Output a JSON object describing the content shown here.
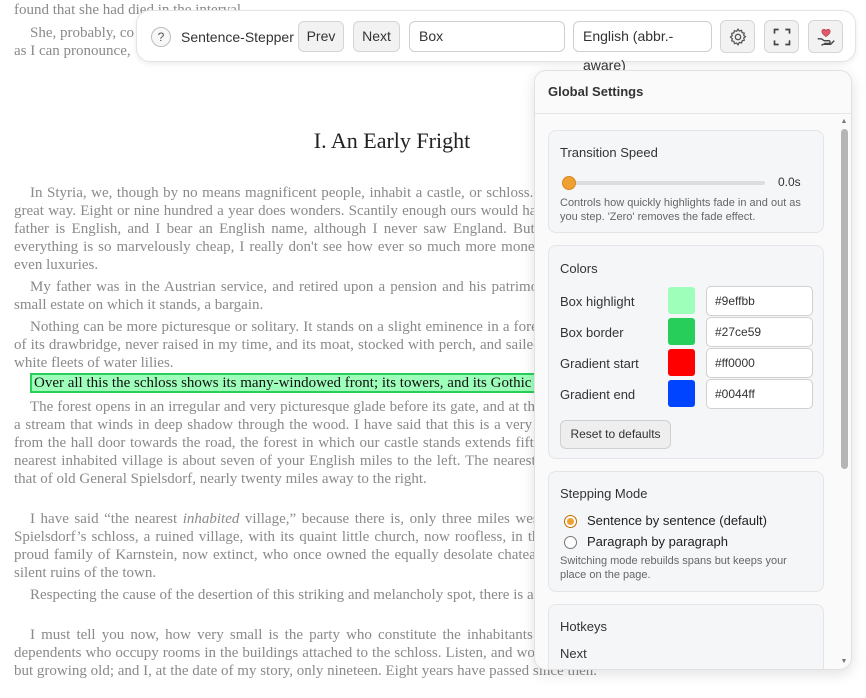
{
  "book": {
    "top_line_1": "found that she had died in the interval.",
    "top_line_2": "She, probably, co",
    "top_line_3": "as I can pronounce,",
    "chapter_title": "I. An Early Fright",
    "p1": "In Styria, we, though by no means magnificent people, inhabit a castle, or schloss. A small income, in that part of the world, goes a great way. Eight or nine hundred a year does wonders. Scantily enough ours would have answered among wealthy people at home. My father is English, and I bear an English name, although I never saw England. But here, in this lonely and primitive place, where everything is so marvelously cheap, I really don't see how ever so much more money would at all materially add to our comforts, or even luxuries.",
    "p2": "My father was in the Austrian service, and retired upon a pension and his patrimony, and purchased this feudal residence, and the small estate on which it stands, a bargain.",
    "p3": "Nothing can be more picturesque or solitary. It stands on a slight eminence in a forest. The road, very old and narrow, passes in front of its drawbridge, never raised in my time, and its moat, stocked with perch, and sailed over by many swans, and floating on its surface white fleets of water lilies.",
    "highlight": "Over all this the schloss shows its many-windowed front; its towers, and its Gothic chapel.",
    "p4": "The forest opens in an irregular and very picturesque glade before its gate, and at the right a steep Gothic bridge carries the road over a stream that winds in deep shadow through the wood. I have said that this is a very lonely place. Judge whether I say truth. Looking from the hall door towards the road, the forest in which our castle stands extends fifteen miles to the right, and twelve to the left. The nearest inhabited village is about seven of your English miles to the left. The nearest inhabited schloss of any historic associations, is that of old General Spielsdorf, nearly twenty miles away to the right.",
    "p5_a": "I have said “the nearest ",
    "p5_em": "inhabited",
    "p5_b": " village,” because there is, only three miles westward, that is to say in the direction of General Spielsdorf’s schloss, a ruined village, with its quaint little church, now roofless, in the aisle of which are the moldering tombs of the proud family of Karnstein, now extinct, who once owned the equally desolate chateau which, in the thick of the forest, overlooks the silent ruins of the town.",
    "p6": "Respecting the cause of the desertion of this striking and melancholy spot, there is a legend which I shall relate to you another time.",
    "p7": "I must tell you now, how very small is the party who constitute the inhabitants of our castle. I don't include servants, or those dependents who occupy rooms in the buildings attached to the schloss. Listen, and wonder! My father, who is the kindest man on earth, but growing old; and I, at the date of my story, only nineteen. Eight years have passed since then."
  },
  "toolbar": {
    "help": "?",
    "title": "Sentence-Stepper",
    "prev": "Prev",
    "next": "Next",
    "search_value": "Box",
    "language": "English (abbr.-aware)"
  },
  "panel": {
    "title": "Global Settings",
    "transition": {
      "title": "Transition Speed",
      "value_label": "0.0s",
      "value": 0,
      "help": "Controls how quickly highlights fade in and out as you step. 'Zero' removes the fade effect."
    },
    "colors": {
      "title": "Colors",
      "rows": [
        {
          "label": "Box highlight",
          "hex": "#9effbb"
        },
        {
          "label": "Box border",
          "hex": "#27ce59"
        },
        {
          "label": "Gradient start",
          "hex": "#ff0000"
        },
        {
          "label": "Gradient end",
          "hex": "#0044ff"
        }
      ],
      "reset": "Reset to defaults"
    },
    "stepping": {
      "title": "Stepping Mode",
      "options": [
        {
          "label": "Sentence by sentence (default)",
          "checked": true
        },
        {
          "label": "Paragraph by paragraph",
          "checked": false
        }
      ],
      "help": "Switching mode rebuilds spans but keeps your place on the page."
    },
    "hotkeys": {
      "title": "Hotkeys",
      "first": "Next"
    }
  }
}
